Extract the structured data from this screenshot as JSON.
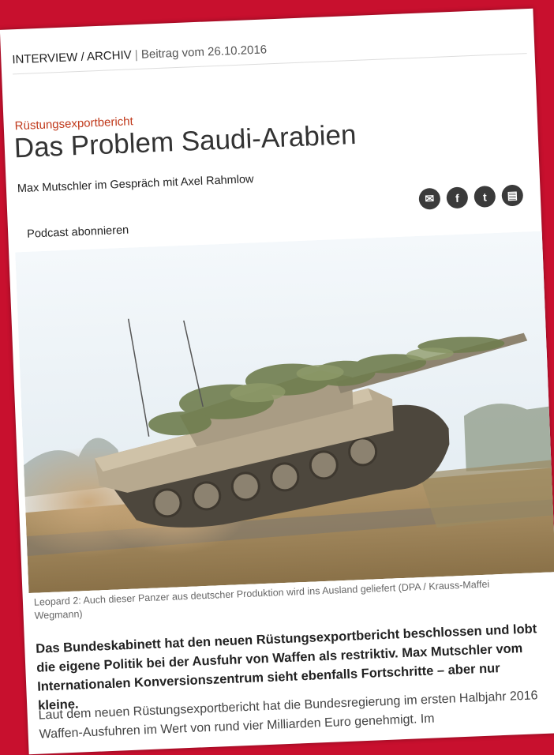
{
  "header": {
    "section": "INTERVIEW / ARCHIV",
    "separator": "|",
    "date": "Beitrag vom 26.10.2016"
  },
  "article": {
    "kicker": "Rüstungsexportbericht",
    "title": "Das Problem Saudi-Arabien",
    "byline": "Max Mutschler im Gespräch mit Axel Rahmlow",
    "podcast_label": "Podcast abonnieren",
    "caption": "Leopard 2: Auch dieser Panzer aus deutscher Produktion wird ins Ausland geliefert (DPA / Krauss-Maffei Wegmann)",
    "lead": "Das Bundeskabinett hat den neuen Rüstungsexportbericht beschlossen und lobt die eigene Politik bei der Ausfuhr von Waffen als restriktiv. Max Mutschler vom Internationalen Konversionszentrum sieht ebenfalls Fortschritte – aber nur kleine.",
    "body": "Laut dem neuen Rüstungsexportbericht hat die Bundesregierung im ersten Halbjahr 2016 Waffen-Ausfuhren im Wert von rund vier Milliarden Euro genehmigt. Im"
  },
  "share": [
    {
      "name": "email-icon",
      "glyph": "✉"
    },
    {
      "name": "facebook-icon",
      "glyph": "f"
    },
    {
      "name": "twitter-icon",
      "glyph": "t"
    },
    {
      "name": "print-icon",
      "glyph": "▤"
    }
  ],
  "colors": {
    "background": "#c8102e",
    "kicker": "#c0391b",
    "icon": "#3a3a3a"
  }
}
